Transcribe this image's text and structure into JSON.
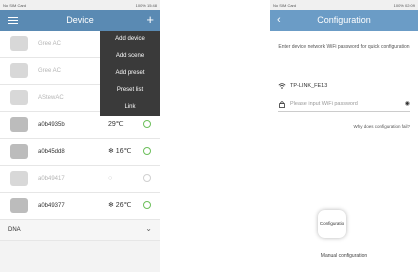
{
  "left": {
    "status": {
      "carrier": "No SIM Card",
      "battery": "100%",
      "time": "15:48"
    },
    "appbar": {
      "title": "Device"
    },
    "devices": [
      {
        "name": "Gree AC",
        "temp": "",
        "state": "off"
      },
      {
        "name": "Gree AC",
        "temp": "",
        "state": "off"
      },
      {
        "name": "AStewAC",
        "temp": "",
        "state": "off"
      },
      {
        "name": "a0b4935b",
        "temp": "29℃",
        "state": "on"
      },
      {
        "name": "a0b45dd8",
        "temp": "❄ 16℃",
        "state": "on"
      },
      {
        "name": "a0b49417",
        "temp": "○",
        "state": "off"
      },
      {
        "name": "a0b49377",
        "temp": "❄ 26℃",
        "state": "on"
      }
    ],
    "group": {
      "name": "DNA"
    },
    "menu": [
      "Add device",
      "Add scene",
      "Add preset",
      "Preset list",
      "Link"
    ]
  },
  "right": {
    "status": {
      "carrier": "No SIM Card",
      "battery": "100%",
      "time": "02:09"
    },
    "appbar": {
      "title": "Configuration"
    },
    "prompt": "Enter device network WiFi password for quick configuration",
    "wifi_name": "TP-LINK_FE13",
    "password_placeholder": "Please input WiFi password",
    "help_link": "Why does configuration fail?",
    "config_button": "Configuratio",
    "manual_label": "Manual configuration"
  },
  "colors": {
    "appbar": "#5a8ab3",
    "menu_bg": "#3a3a3a",
    "power_on": "#6cbf5a"
  }
}
